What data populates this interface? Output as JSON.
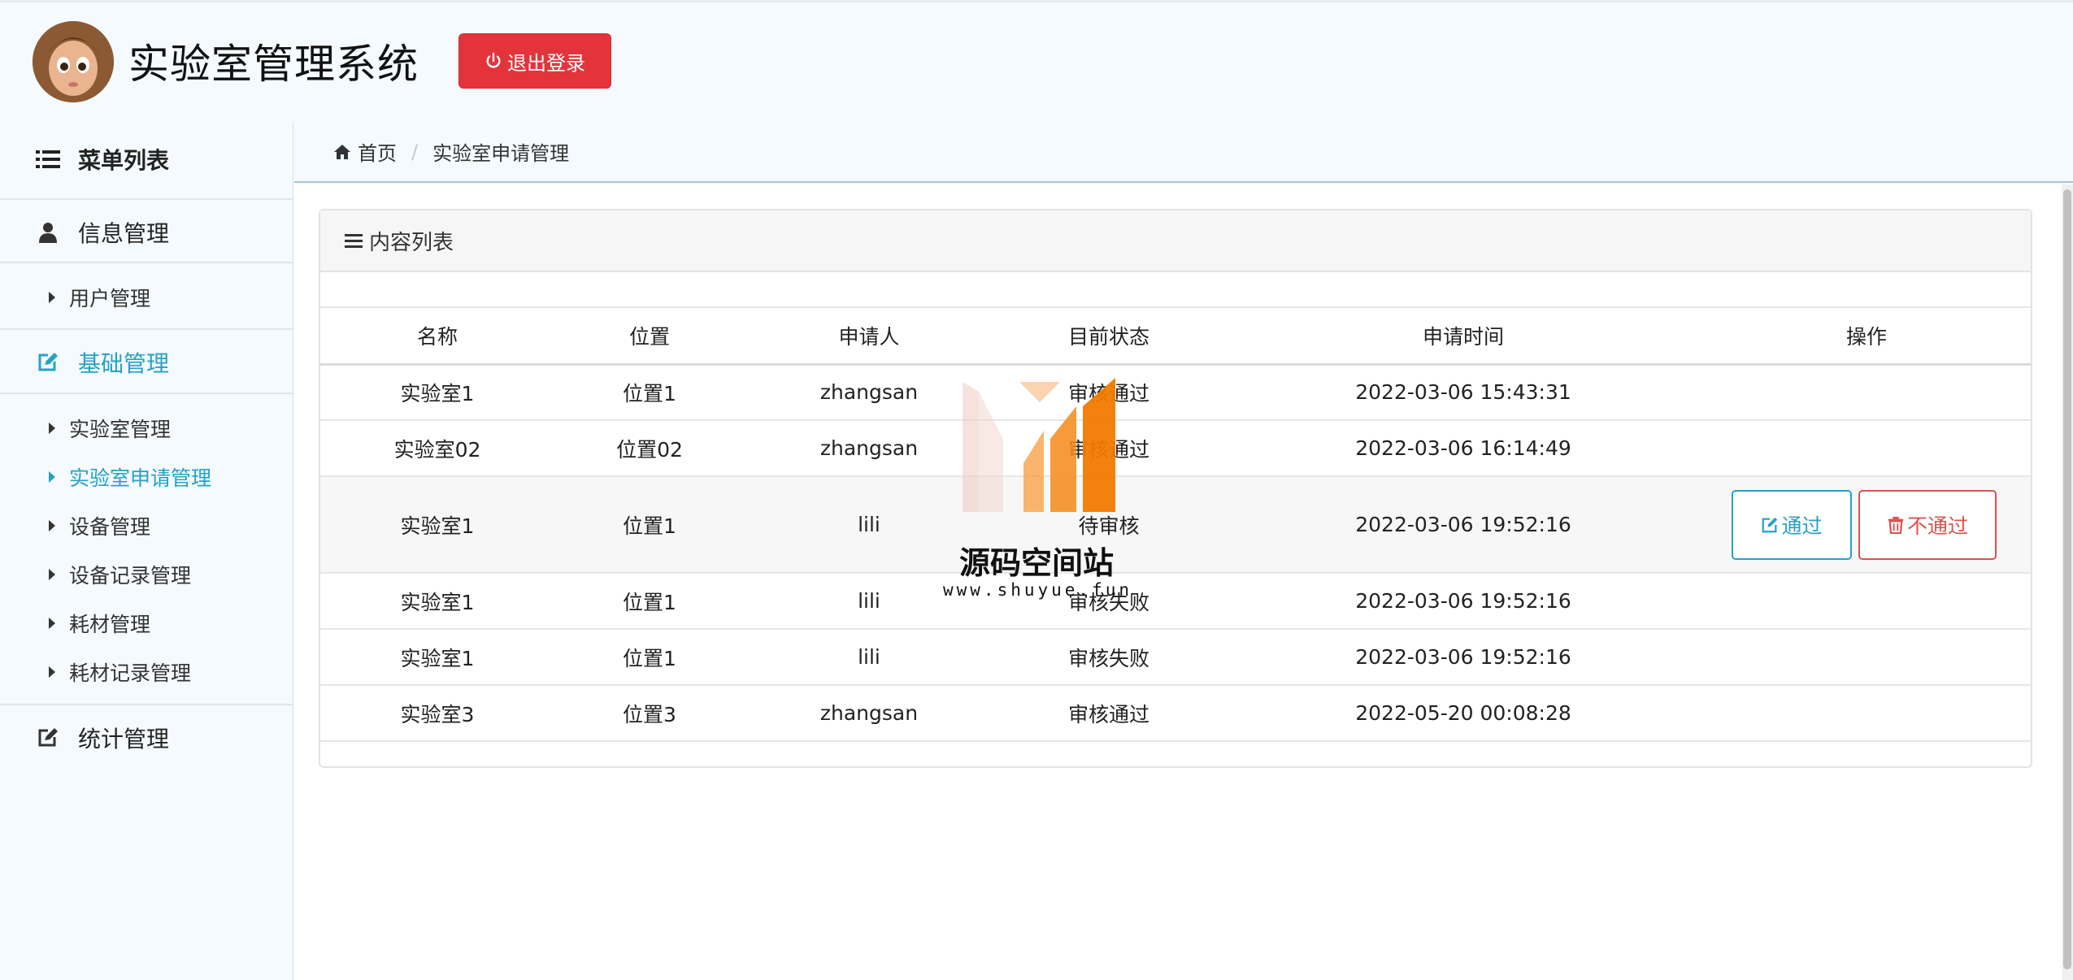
{
  "header": {
    "title": "实验室管理系统",
    "logout_label": "退出登录"
  },
  "sidebar": {
    "menu_title": "菜单列表",
    "groups": [
      {
        "label": "信息管理",
        "items": [
          {
            "label": "用户管理"
          }
        ]
      },
      {
        "label": "基础管理",
        "items": [
          {
            "label": "实验室管理"
          },
          {
            "label": "实验室申请管理"
          },
          {
            "label": "设备管理"
          },
          {
            "label": "设备记录管理"
          },
          {
            "label": "耗材管理"
          },
          {
            "label": "耗材记录管理"
          }
        ]
      },
      {
        "label": "统计管理",
        "items": []
      }
    ],
    "active_item": "实验室申请管理"
  },
  "breadcrumb": {
    "home": "首页",
    "current": "实验室申请管理"
  },
  "panel": {
    "title": "内容列表"
  },
  "table": {
    "columns": [
      "名称",
      "位置",
      "申请人",
      "目前状态",
      "申请时间",
      "操作"
    ],
    "rows": [
      [
        "实验室1",
        "位置1",
        "zhangsan",
        "审核通过",
        "2022-03-06 15:43:31"
      ],
      [
        "实验室02",
        "位置02",
        "zhangsan",
        "审核通过",
        "2022-03-06 16:14:49"
      ],
      [
        "实验室1",
        "位置1",
        "lili",
        "待审核",
        "2022-03-06 19:52:16"
      ],
      [
        "实验室1",
        "位置1",
        "lili",
        "审核失败",
        "2022-03-06 19:52:16"
      ],
      [
        "实验室1",
        "位置1",
        "lili",
        "审核失败",
        "2022-03-06 19:52:16"
      ],
      [
        "实验室3",
        "位置3",
        "zhangsan",
        "审核通过",
        "2022-05-20 00:08:28"
      ]
    ],
    "actions": {
      "pass": "通过",
      "reject": "不通过"
    }
  },
  "watermark": {
    "name": "源码空间站",
    "url": "www.shuyue.fun"
  },
  "colors": {
    "accent": "#27a1c4",
    "danger": "#e3343c",
    "background": "#f4fafd"
  }
}
